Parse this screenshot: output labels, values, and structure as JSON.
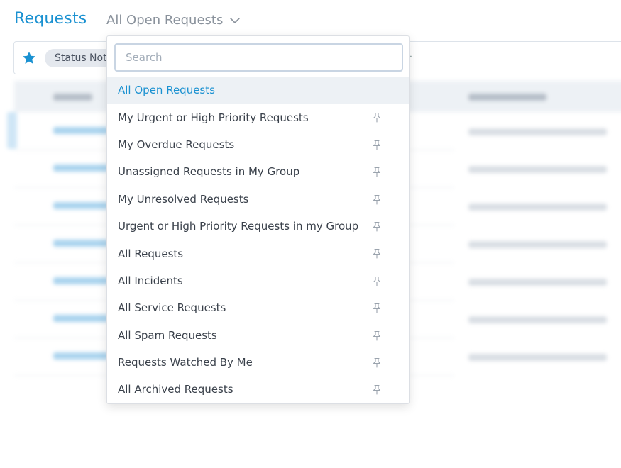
{
  "header": {
    "title": "Requests",
    "view_label": "All Open Requests",
    "chevron_icon": "chevron-down-icon"
  },
  "filter_bar": {
    "star_icon": "star-icon",
    "chip_label": "Status Not",
    "trailing_text": "."
  },
  "colors": {
    "accent": "#1a91d1",
    "star": "#1a91d1",
    "selected_bg": "#edf1f5"
  },
  "dropdown": {
    "search_placeholder": "Search",
    "search_value": "",
    "selected_index": 0,
    "options": [
      {
        "label": "All Open Requests",
        "pinned": false
      },
      {
        "label": "My Urgent or High Priority Requests",
        "pinned": true
      },
      {
        "label": "My Overdue Requests",
        "pinned": true
      },
      {
        "label": "Unassigned Requests in My Group",
        "pinned": true
      },
      {
        "label": "My Unresolved Requests",
        "pinned": true
      },
      {
        "label": "Urgent or High Priority Requests in my Group",
        "pinned": true
      },
      {
        "label": "All Requests",
        "pinned": true
      },
      {
        "label": "All Incidents",
        "pinned": true
      },
      {
        "label": "All Service Requests",
        "pinned": true
      },
      {
        "label": "All Spam Requests",
        "pinned": true
      },
      {
        "label": "Requests Watched By Me",
        "pinned": true
      },
      {
        "label": "All Archived Requests",
        "pinned": true
      }
    ]
  }
}
